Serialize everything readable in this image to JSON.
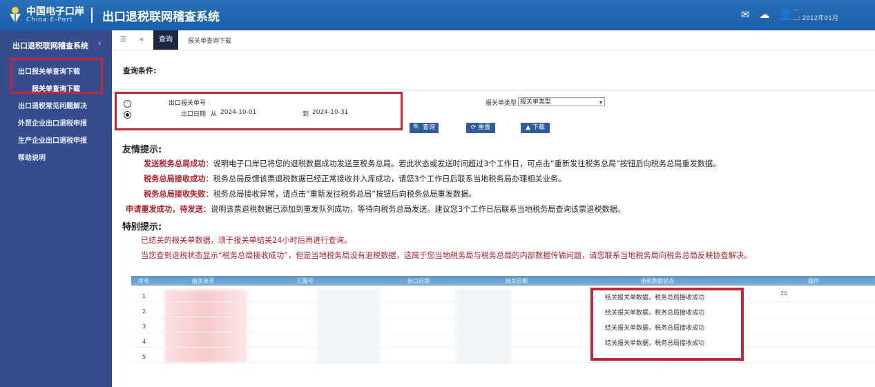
{
  "header": {
    "logo_cn": "中国电子口岸",
    "logo_en": "China E-Port",
    "system_title": "出口退税联网稽查系统",
    "user_line1": "...",
    "user_line2": "...: 2012年01月"
  },
  "sidebar": {
    "title": "出口退税联网稽查系统",
    "items": [
      {
        "label": "出口报关单查询下载"
      },
      {
        "label": "报关单查询下载"
      },
      {
        "label": "出口退税常见问题解决"
      },
      {
        "label": "外贸企业出口退税申报"
      },
      {
        "label": "生产企业出口退税申报"
      },
      {
        "label": "帮助说明"
      }
    ]
  },
  "tabs": {
    "active": "查询",
    "label": "报关单查询下载"
  },
  "query": {
    "label": "查询条件:",
    "option1": "出口报关单号",
    "option2_label": "出口日期",
    "from_label": "从",
    "from_date": "2024-10-01",
    "to_label": "到",
    "to_date": "2024-10-31",
    "type_label": "报关单类型",
    "type_value": "报关单类型",
    "buttons": [
      "查询",
      "重置",
      "下载"
    ]
  },
  "tips": {
    "title": "友情提示:",
    "rows": [
      {
        "key": "发送税务总局成功",
        "text": "：说明电子口岸已将您的退税数据成功发送至税务总局。若此状态或发送时间超过3个工作日，可点击“重新发往税务总局”按钮后向税务总局重发数据。"
      },
      {
        "key": "税务总局接收成功",
        "text": "：税务总局反馈该票退税数据已经正常接收并入库成功，请您3个工作日后联系当地税务局办理相关业务。"
      },
      {
        "key": "税务总局接收失败",
        "text": "：税务总局接收异常，请点击“重新发往税务总局”按钮后向税务总局重发数据。"
      },
      {
        "key": "申请重发成功，待发送",
        "text": "：说明该票退税数据已添加到重发队列成功，等待向税务总局发送。建议您3个工作日后联系当地税务局查询该票退税数据。"
      }
    ]
  },
  "special": {
    "title": "特别提示:",
    "rows": [
      "已结关的报关单数据，须于报关单结关24小时后再进行查询。",
      "当您查到退税状态显示“税务总局接收成功”，但是当地税务局没有退税数据，这属于您当地税务局与税务总局的内部数据传输问题，请您联系当地税务局向税务总局反映协查解决。"
    ]
  },
  "table": {
    "headers": [
      "序号",
      "报关单号",
      "汇票号",
      "出口日期",
      "结关日期",
      "退税数据状态",
      "操作"
    ],
    "rows": [
      {
        "num": "1",
        "status": "结关报关单数据，税务总局接收成功"
      },
      {
        "num": "2",
        "status": "结关报关单数据，税务总局接收成功"
      },
      {
        "num": "3",
        "status": "结关报关单数据，税务总局接收成功"
      },
      {
        "num": "4",
        "status": "结关报关单数据，税务总局接收成功"
      },
      {
        "num": "5",
        "status": ""
      }
    ],
    "extra": "20"
  }
}
